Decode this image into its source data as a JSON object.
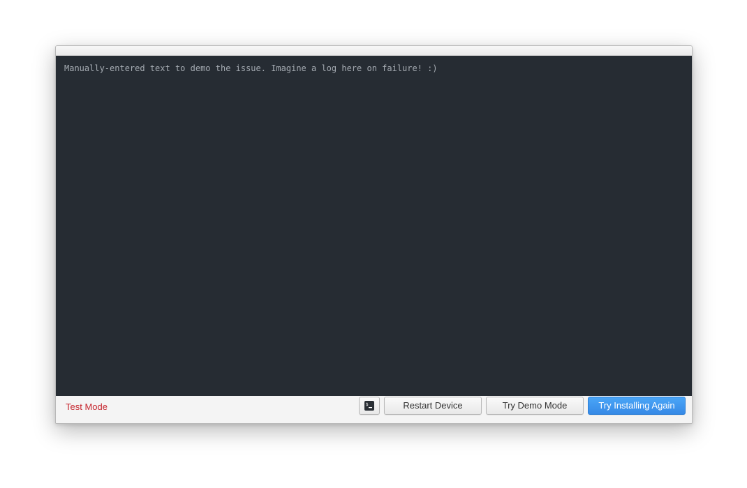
{
  "terminal": {
    "log_text": "Manually-entered text to demo the issue. Imagine a log here on failure! :)"
  },
  "footer": {
    "test_mode_label": "Test Mode",
    "terminal_toggle_icon": "terminal-icon",
    "restart_label": "Restart Device",
    "demo_label": "Try Demo Mode",
    "install_again_label": "Try Installing Again"
  },
  "colors": {
    "terminal_background": "#262c33",
    "terminal_text": "#a4aab1",
    "test_mode_text": "#c6262e",
    "primary_button": "#3689e6"
  }
}
